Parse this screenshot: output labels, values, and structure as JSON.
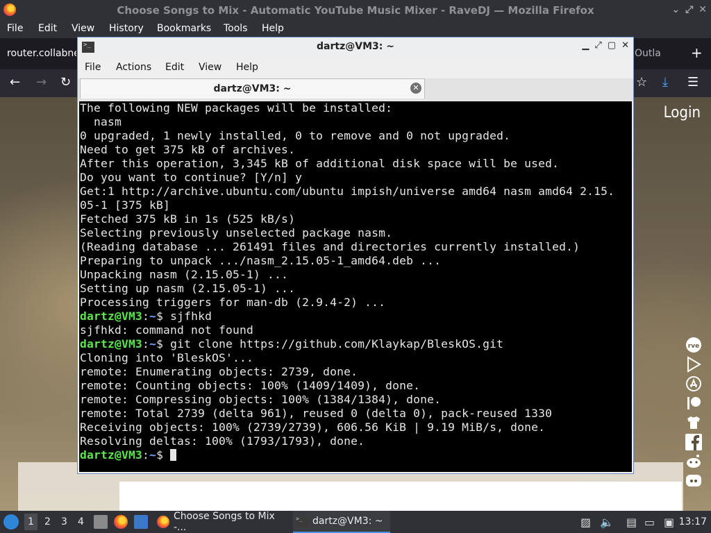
{
  "firefox": {
    "window_title": "Choose Songs to Mix - Automatic YouTube Music Mixer - RaveDJ — Mozilla Firefox",
    "menu": [
      "File",
      "Edit",
      "View",
      "History",
      "Bookmarks",
      "Tools",
      "Help"
    ],
    "tabs": {
      "left_tab": "router.collabnet",
      "right_tab": "Outla",
      "new_tab": "+"
    },
    "page": {
      "login_label": "Login"
    }
  },
  "terminal": {
    "window_title": "dartz@VM3: ~",
    "menu": [
      "File",
      "Actions",
      "Edit",
      "View",
      "Help"
    ],
    "tab_title": "dartz@VM3: ~",
    "prompt_user": "dartz@VM3",
    "prompt_path": "~",
    "lines": [
      {
        "type": "out",
        "text": "The following NEW packages will be installed:"
      },
      {
        "type": "out",
        "text": "  nasm"
      },
      {
        "type": "out",
        "text": "0 upgraded, 1 newly installed, 0 to remove and 0 not upgraded."
      },
      {
        "type": "out",
        "text": "Need to get 375 kB of archives."
      },
      {
        "type": "out",
        "text": "After this operation, 3,345 kB of additional disk space will be used."
      },
      {
        "type": "out",
        "text": "Do you want to continue? [Y/n] y"
      },
      {
        "type": "out",
        "text": "Get:1 http://archive.ubuntu.com/ubuntu impish/universe amd64 nasm amd64 2.15."
      },
      {
        "type": "out",
        "text": "05-1 [375 kB]"
      },
      {
        "type": "out",
        "text": "Fetched 375 kB in 1s (525 kB/s)"
      },
      {
        "type": "out",
        "text": "Selecting previously unselected package nasm."
      },
      {
        "type": "out",
        "text": "(Reading database ... 261491 files and directories currently installed.)"
      },
      {
        "type": "out",
        "text": "Preparing to unpack .../nasm_2.15.05-1_amd64.deb ..."
      },
      {
        "type": "out",
        "text": "Unpacking nasm (2.15.05-1) ..."
      },
      {
        "type": "out",
        "text": "Setting up nasm (2.15.05-1) ..."
      },
      {
        "type": "out",
        "text": "Processing triggers for man-db (2.9.4-2) ..."
      },
      {
        "type": "cmd",
        "text": "sjfhkd"
      },
      {
        "type": "out",
        "text": "sjfhkd: command not found"
      },
      {
        "type": "cmd",
        "text": "git clone https://github.com/Klaykap/BleskOS.git"
      },
      {
        "type": "out",
        "text": "Cloning into 'BleskOS'..."
      },
      {
        "type": "out",
        "text": "remote: Enumerating objects: 2739, done."
      },
      {
        "type": "out",
        "text": "remote: Counting objects: 100% (1409/1409), done."
      },
      {
        "type": "out",
        "text": "remote: Compressing objects: 100% (1384/1384), done."
      },
      {
        "type": "out",
        "text": "remote: Total 2739 (delta 961), reused 0 (delta 0), pack-reused 1330"
      },
      {
        "type": "out",
        "text": "Receiving objects: 100% (2739/2739), 606.56 KiB | 9.19 MiB/s, done."
      },
      {
        "type": "out",
        "text": "Resolving deltas: 100% (1793/1793), done."
      },
      {
        "type": "cmd",
        "text": ""
      }
    ]
  },
  "taskbar": {
    "workspaces": [
      "1",
      "2",
      "3",
      "4"
    ],
    "tasks": [
      {
        "label": "Choose Songs to Mix -...",
        "icon": "firefox-icon"
      },
      {
        "label": "dartz@VM3: ~",
        "icon": "terminal-icon"
      }
    ],
    "clock": "13:17"
  }
}
